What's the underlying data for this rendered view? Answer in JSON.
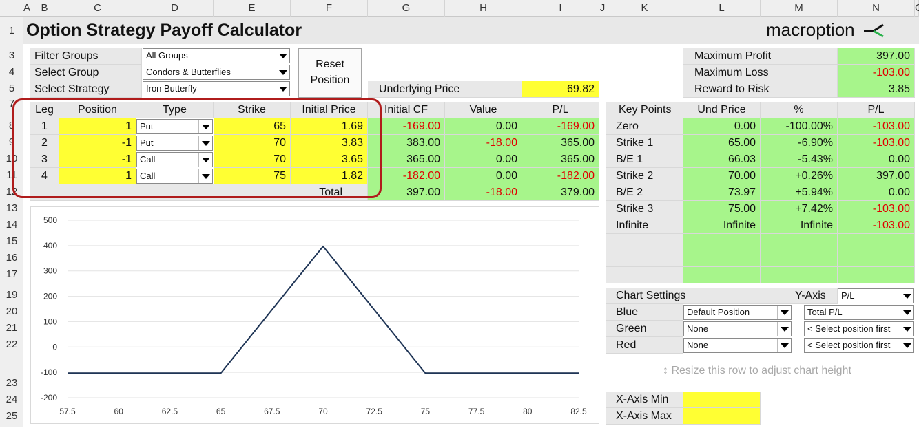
{
  "column_headers": [
    "A",
    "B",
    "C",
    "D",
    "E",
    "F",
    "G",
    "H",
    "I",
    "J",
    "K",
    "L",
    "M",
    "N",
    "O"
  ],
  "row_headers": [
    "1",
    "3",
    "4",
    "5",
    "7",
    "8",
    "9",
    "10",
    "11",
    "12",
    "13",
    "14",
    "15",
    "16",
    "17",
    "19",
    "20",
    "21",
    "22",
    "23",
    "24",
    "25"
  ],
  "title": "Option Strategy Payoff Calculator",
  "logo_text": "macroption",
  "filters": {
    "filter_groups_label": "Filter Groups",
    "filter_groups_value": "All Groups",
    "select_group_label": "Select Group",
    "select_group_value": "Condors & Butterflies",
    "select_strategy_label": "Select Strategy",
    "select_strategy_value": "Iron Butterfly"
  },
  "reset_button": {
    "line1": "Reset",
    "line2": "Position"
  },
  "underlying": {
    "label": "Underlying Price",
    "value": "69.82"
  },
  "summary": {
    "max_profit_label": "Maximum Profit",
    "max_profit": "397.00",
    "max_loss_label": "Maximum Loss",
    "max_loss": "-103.00",
    "rr_label": "Reward to Risk",
    "rr": "3.85"
  },
  "legs_table": {
    "headers": [
      "Leg",
      "Position",
      "Type",
      "Strike",
      "Initial Price",
      "Initial CF",
      "Value",
      "P/L"
    ],
    "rows": [
      {
        "leg": "1",
        "position": "1",
        "type": "Put",
        "strike": "65",
        "price": "1.69",
        "cf": "-169.00",
        "value": "0.00",
        "pl": "-169.00"
      },
      {
        "leg": "2",
        "position": "-1",
        "type": "Put",
        "strike": "70",
        "price": "3.83",
        "cf": "383.00",
        "value": "-18.00",
        "pl": "365.00"
      },
      {
        "leg": "3",
        "position": "-1",
        "type": "Call",
        "strike": "70",
        "price": "3.65",
        "cf": "365.00",
        "value": "0.00",
        "pl": "365.00"
      },
      {
        "leg": "4",
        "position": "1",
        "type": "Call",
        "strike": "75",
        "price": "1.82",
        "cf": "-182.00",
        "value": "0.00",
        "pl": "-182.00"
      }
    ],
    "total_label": "Total",
    "total_cf": "397.00",
    "total_value": "-18.00",
    "total_pl": "379.00"
  },
  "key_points": {
    "headers": [
      "Key Points",
      "Und Price",
      "%",
      "P/L"
    ],
    "rows": [
      {
        "name": "Zero",
        "price": "0.00",
        "pct": "-100.00%",
        "pl": "-103.00"
      },
      {
        "name": "Strike 1",
        "price": "65.00",
        "pct": "-6.90%",
        "pl": "-103.00"
      },
      {
        "name": "B/E 1",
        "price": "66.03",
        "pct": "-5.43%",
        "pl": "0.00"
      },
      {
        "name": "Strike 2",
        "price": "70.00",
        "pct": "+0.26%",
        "pl": "397.00"
      },
      {
        "name": "B/E 2",
        "price": "73.97",
        "pct": "+5.94%",
        "pl": "0.00"
      },
      {
        "name": "Strike 3",
        "price": "75.00",
        "pct": "+7.42%",
        "pl": "-103.00"
      },
      {
        "name": "Infinite",
        "price": "Infinite",
        "pct": "Infinite",
        "pl": "-103.00"
      }
    ]
  },
  "chart_settings": {
    "label": "Chart Settings",
    "yaxis_label": "Y-Axis",
    "yaxis_value": "P/L",
    "blue_label": "Blue",
    "blue_pos": "Default Position",
    "blue_series": "Total P/L",
    "green_label": "Green",
    "green_pos": "None",
    "green_series": "< Select position first",
    "red_label": "Red",
    "red_pos": "None",
    "red_series": "< Select position first"
  },
  "resize_hint": "Resize this row to adjust chart height",
  "xaxis": {
    "min_label": "X-Axis Min",
    "max_label": "X-Axis Max"
  },
  "colors": {
    "line": "#1f3556",
    "green": "#a7f58b",
    "yellow": "#ffff33",
    "negative": "#e00000",
    "highlight_oval": "#b01c1c"
  },
  "chart_data": {
    "type": "line",
    "x": [
      57.5,
      65,
      66.03,
      70,
      73.97,
      75,
      82.5
    ],
    "y": [
      -103,
      -103,
      0,
      397,
      0,
      -103,
      -103
    ],
    "xticks": [
      57.5,
      60,
      62.5,
      65,
      67.5,
      70,
      72.5,
      75,
      77.5,
      80,
      82.5
    ],
    "yticks": [
      -200,
      -100,
      0,
      100,
      200,
      300,
      400,
      500
    ],
    "xlim": [
      57.5,
      82.5
    ],
    "ylim": [
      -200,
      500
    ],
    "title": "",
    "xlabel": "",
    "ylabel": "",
    "grid": "horizontal"
  }
}
